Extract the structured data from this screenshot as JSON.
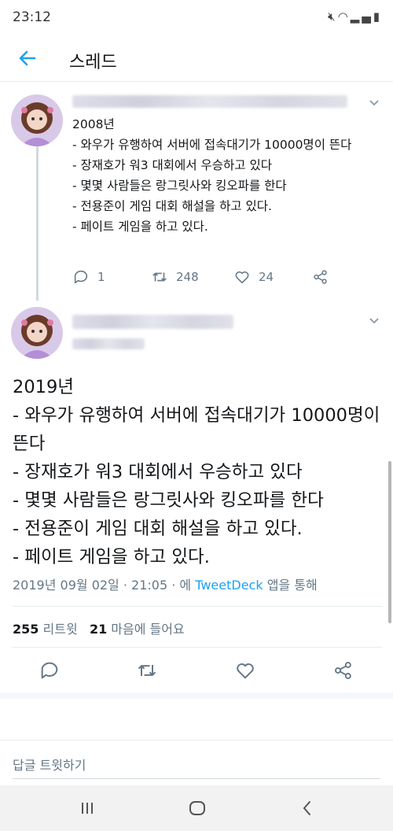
{
  "status_bar": {
    "time": "23:12",
    "icons": [
      "mute-icon",
      "wifi-icon",
      "signal-icon",
      "battery-icon"
    ]
  },
  "header": {
    "title": "스레드"
  },
  "reply_tweet": {
    "text": "2008년\n- 와우가 유행하여 서버에 접속대기가 10000명이 뜬다\n- 장재호가 워3 대회에서 우승하고 있다\n- 몇몇 사람들은 랑그릿사와 킹오파를 한다\n- 전용준이 게임 대회 해설을 하고 있다.\n- 페이트 게임을 하고 있다.",
    "replies": "1",
    "retweets": "248",
    "likes": "24"
  },
  "main_tweet": {
    "text": "2019년\n- 와우가 유행하여 서버에 접속대기가 10000명이 뜬다\n- 장재호가 워3 대회에서 우승하고 있다\n- 몇몇 사람들은 랑그릿사와 킹오파를 한다\n- 전용준이 게임 대회 해설을 하고 있다.\n- 페이트 게임을 하고 있다.",
    "timestamp": "2019년 09월 02일 · 21:05 · 에",
    "client": "TweetDeck",
    "via": "앱을 통해",
    "retweet_count": "255",
    "retweet_label": "리트윗",
    "like_count": "21",
    "like_label": "마음에 들어요"
  },
  "reply_box": {
    "placeholder": "답글 트윗하기"
  },
  "colors": {
    "accent": "#1da1f2",
    "secondary_text": "#657786",
    "divider": "#e6ecf0"
  }
}
